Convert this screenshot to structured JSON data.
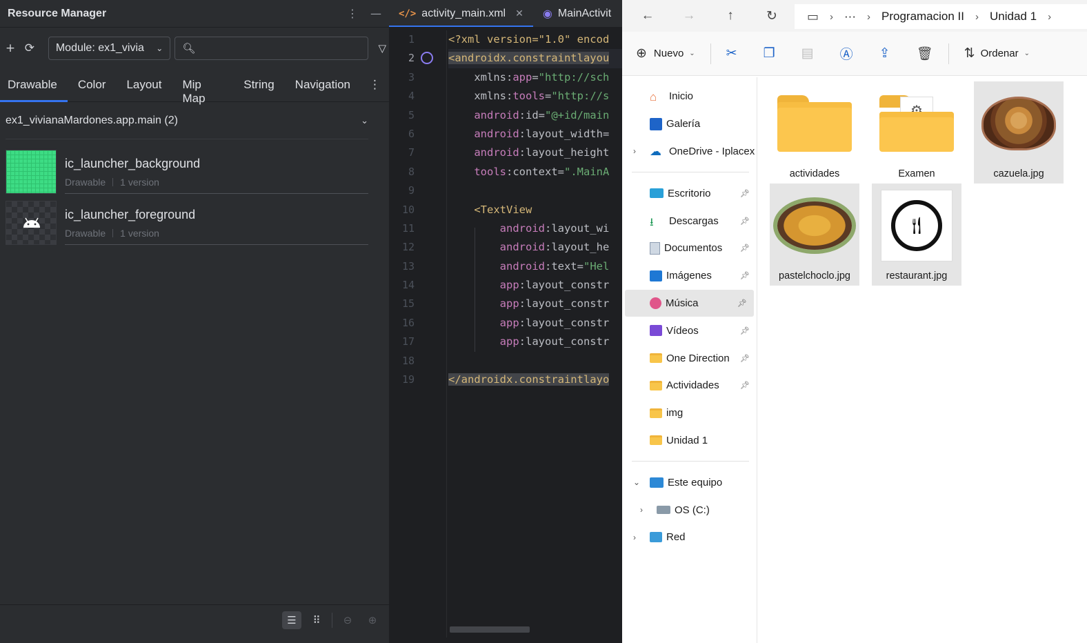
{
  "resource_manager": {
    "title": "Resource Manager",
    "add_icon": "plus-icon",
    "refresh_icon": "refresh-icon",
    "module_select": "Module: ex1_vivia",
    "search_placeholder": "",
    "tabs": [
      "Drawable",
      "Color",
      "Layout",
      "Mip Map",
      "String",
      "Navigation"
    ],
    "active_tab": "Drawable",
    "group": "ex1_vivianaMardones.app.main (2)",
    "resources": [
      {
        "name": "ic_launcher_background",
        "type": "Drawable",
        "versions": "1 version"
      },
      {
        "name": "ic_launcher_foreground",
        "type": "Drawable",
        "versions": "1 version"
      }
    ]
  },
  "editor": {
    "tabs": [
      {
        "label": "activity_main.xml",
        "icon": "xml-icon"
      },
      {
        "label": "MainActivit",
        "icon": "kotlin-class-icon"
      }
    ],
    "line_numbers": [
      "1",
      "2",
      "3",
      "4",
      "5",
      "6",
      "7",
      "8",
      "9",
      "10",
      "11",
      "12",
      "13",
      "14",
      "15",
      "16",
      "17",
      "18",
      "19"
    ],
    "current_line": "2",
    "lines": [
      [
        [
          "tag",
          "<?xml version=\"1.0\" encod"
        ]
      ],
      [
        [
          "hltag",
          "<androidx.constraintlayou"
        ]
      ],
      [
        [
          "attr",
          "    xmlns:"
        ],
        [
          "ns",
          "app"
        ],
        [
          "attr",
          "="
        ],
        [
          "str",
          "\"http://sch"
        ]
      ],
      [
        [
          "attr",
          "    xmlns:"
        ],
        [
          "ns",
          "tools"
        ],
        [
          "attr",
          "="
        ],
        [
          "str",
          "\"http://s"
        ]
      ],
      [
        [
          "ns",
          "    android"
        ],
        [
          "attr",
          ":id="
        ],
        [
          "str",
          "\"@+id/main"
        ]
      ],
      [
        [
          "ns",
          "    android"
        ],
        [
          "attr",
          ":layout_width="
        ]
      ],
      [
        [
          "ns",
          "    android"
        ],
        [
          "attr",
          ":layout_height"
        ]
      ],
      [
        [
          "ns",
          "    tools"
        ],
        [
          "attr",
          ":context="
        ],
        [
          "str",
          "\".MainA"
        ]
      ],
      [
        [
          "attr",
          ""
        ]
      ],
      [
        [
          "tag",
          "    <TextView"
        ]
      ],
      [
        [
          "ns",
          "        android"
        ],
        [
          "attr",
          ":layout_wi"
        ]
      ],
      [
        [
          "ns",
          "        android"
        ],
        [
          "attr",
          ":layout_he"
        ]
      ],
      [
        [
          "ns",
          "        android"
        ],
        [
          "attr",
          ":text="
        ],
        [
          "str",
          "\"Hel"
        ]
      ],
      [
        [
          "ns",
          "        app"
        ],
        [
          "attr",
          ":layout_constr"
        ]
      ],
      [
        [
          "ns",
          "        app"
        ],
        [
          "attr",
          ":layout_constr"
        ]
      ],
      [
        [
          "ns",
          "        app"
        ],
        [
          "attr",
          ":layout_constr"
        ]
      ],
      [
        [
          "ns",
          "        app"
        ],
        [
          "attr",
          ":layout_constr"
        ]
      ],
      [
        [
          "attr",
          ""
        ]
      ],
      [
        [
          "hltag",
          "</androidx.constraintlayo"
        ]
      ]
    ]
  },
  "explorer": {
    "breadcrumbs": [
      "Programacion II",
      "Unidad 1"
    ],
    "ellipsis": "···",
    "commands": {
      "new": "Nuevo",
      "sort": "Ordenar"
    },
    "sidebar": {
      "quick": [
        {
          "label": "Inicio",
          "icon": "home-icon"
        },
        {
          "label": "Galería",
          "icon": "gallery-icon"
        },
        {
          "label": "OneDrive - Iplacex",
          "icon": "onedrive-icon"
        }
      ],
      "pinned": [
        {
          "label": "Escritorio",
          "icon": "desktop-icon"
        },
        {
          "label": "Descargas",
          "icon": "download-icon"
        },
        {
          "label": "Documentos",
          "icon": "documents-icon"
        },
        {
          "label": "Imágenes",
          "icon": "pictures-icon"
        },
        {
          "label": "Música",
          "icon": "music-icon"
        },
        {
          "label": "Vídeos",
          "icon": "videos-icon"
        },
        {
          "label": "One Direction",
          "icon": "folder-icon"
        },
        {
          "label": "Actividades",
          "icon": "folder-icon"
        },
        {
          "label": "img",
          "icon": "folder-icon"
        },
        {
          "label": "Unidad 1",
          "icon": "folder-icon"
        }
      ],
      "devices": [
        {
          "label": "Este equipo",
          "icon": "computer-icon"
        },
        {
          "label": "OS (C:)",
          "icon": "drive-icon"
        },
        {
          "label": "Red",
          "icon": "network-icon"
        }
      ],
      "selected": "Música"
    },
    "files": [
      {
        "label": "actividades",
        "kind": "folder"
      },
      {
        "label": "Examen",
        "kind": "folder"
      },
      {
        "label": "cazuela.jpg",
        "kind": "image"
      },
      {
        "label": "pastelchoclo.jpg",
        "kind": "image"
      },
      {
        "label": "restaurant.jpg",
        "kind": "image"
      }
    ],
    "colors": {
      "accent": "#1e64c8",
      "folder": "#fcc64e"
    }
  },
  "colors": {
    "ide_panel": "#2b2d30",
    "ide_editor": "#1e1f22",
    "ide_accent": "#3574f0",
    "xml_tag": "#d5b778",
    "xml_ns": "#c77dbb",
    "xml_string": "#6aab73"
  }
}
